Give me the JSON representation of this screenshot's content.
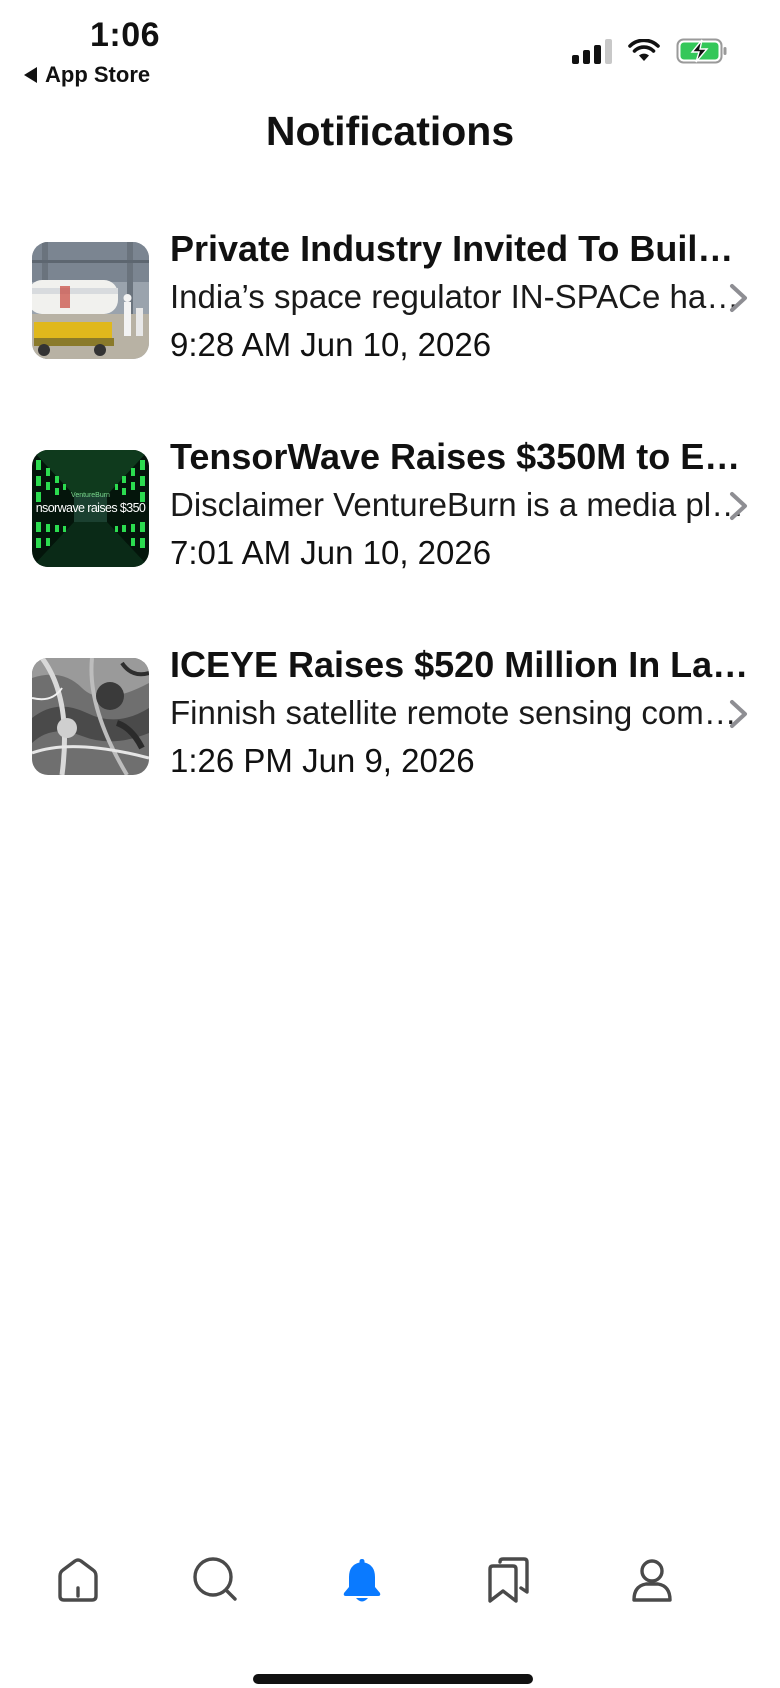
{
  "status_bar": {
    "time": "1:06",
    "back_label": "App Store",
    "icons": [
      "cellular-signal-icon",
      "wifi-icon",
      "battery-charging-icon"
    ],
    "battery_color": "#34c759"
  },
  "header": {
    "title": "Notifications"
  },
  "notifications": [
    {
      "title": "Private Industry Invited To Build…",
      "excerpt": "India’s space regulator IN-SPACe ha…",
      "date": "9:28 AM Jun 10, 2026",
      "thumbnail": "rocket-assembly-thumbnail"
    },
    {
      "title": "TensorWave Raises $350M to E…",
      "excerpt": "Disclaimer VentureBurn is a media pl…",
      "date": "7:01 AM Jun 10, 2026",
      "thumbnail": "server-tunnel-thumbnail",
      "thumbnail_caption_small": "VentureBurn",
      "thumbnail_caption": "nsorwave raises $350"
    },
    {
      "title": "ICEYE Raises $520 Million In La…",
      "excerpt": "Finnish satellite remote sensing com…",
      "date": "1:26 PM Jun 9, 2026",
      "thumbnail": "satellite-radar-thumbnail"
    }
  ],
  "tab_bar": {
    "tabs": [
      "home-icon",
      "search-icon",
      "bell-icon",
      "bookmarks-icon",
      "profile-icon"
    ],
    "active_tab": "bell-icon",
    "active_color": "#0a7aff",
    "inactive_color": "#4a4a4a"
  }
}
